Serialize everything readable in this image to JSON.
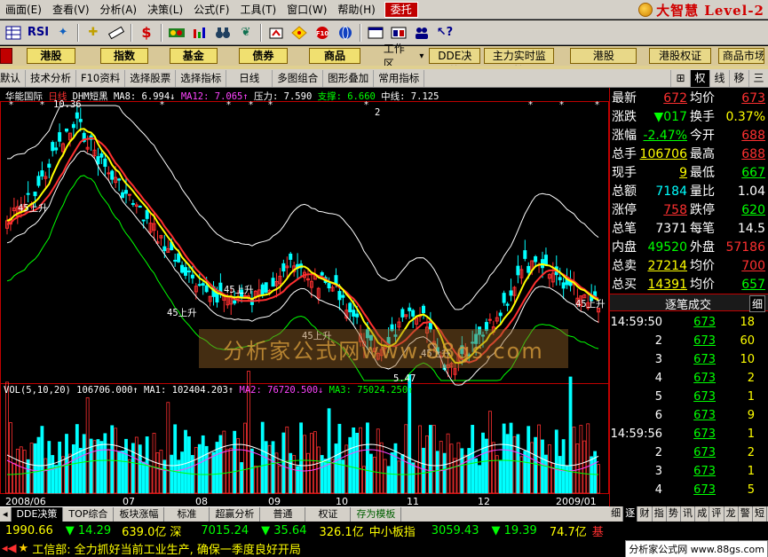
{
  "menu": {
    "items": [
      "画面(E)",
      "查看(V)",
      "分析(A)",
      "决策(L)",
      "公式(F)",
      "工具(T)",
      "窗口(W)",
      "帮助(H)"
    ],
    "hot_button": "委托",
    "brand": "大智慧 Level-2"
  },
  "toolbar": {
    "icons": [
      "grid-icon",
      "rsi-icon",
      "star-icon",
      "move-icon",
      "ruler-icon",
      "money-icon",
      "pattern-icon",
      "flow-icon",
      "binoculars-icon",
      "bird-icon",
      "target-icon",
      "diamond-icon",
      "f10-icon",
      "globe-icon",
      "window-icon",
      "board-icon",
      "users-icon",
      "help-icon"
    ],
    "rsi_label": "RSI"
  },
  "funcbar": {
    "left_buttons": [
      "港股",
      "指数",
      "基金",
      "债券",
      "商品"
    ],
    "workspace_label": "工作区",
    "right_buttons": [
      "DDE决策",
      "主力实时监控",
      "港股",
      "港股权证",
      "商品市场"
    ]
  },
  "subbar": {
    "items": [
      "默认",
      "技术分析",
      "F10资料",
      "选择股票",
      "选择指标",
      "日线",
      "多图组合",
      "图形叠加",
      "常用指标"
    ],
    "tabs": [
      "⊞",
      "权",
      "线",
      "移",
      "三"
    ]
  },
  "chart": {
    "title": "华能国际",
    "period": "日线",
    "indicator": "DHM短黑",
    "ma_text": [
      {
        "text": "MA8: 6.994↓",
        "color": "#ffffff"
      },
      {
        "text": "MA12: 7.065↑",
        "color": "#ff44ff"
      },
      {
        "text": "压力: 7.590",
        "color": "#ffffff"
      },
      {
        "text": "支撑: 6.660",
        "color": "#00ff00"
      },
      {
        "text": "中线: 7.125",
        "color": "#ffffff"
      }
    ],
    "price_max_label": "10.36",
    "price_min_label": "5.47",
    "marker_2": "2",
    "signals": [
      "45上升",
      "45上升",
      "45上升",
      "45上升",
      "45上升",
      "45上升",
      "45上升"
    ],
    "volume_text": [
      {
        "text": "VOL(5,10,20)",
        "color": "#ffffff"
      },
      {
        "text": "106706.000↑",
        "color": "#ffffff"
      },
      {
        "text": "MA1: 102404.203↑",
        "color": "#ffffff"
      },
      {
        "text": "MA2: 76720.500↓",
        "color": "#ff44ff"
      },
      {
        "text": "MA3: 75024.250↑",
        "color": "#00ff00"
      }
    ],
    "x_axis": [
      "2008/06",
      "07",
      "08",
      "09",
      "10",
      "11",
      "12",
      "2009/01"
    ],
    "watermark": "分析家公式网www.88gs.com",
    "colors": {
      "up": "#ff3030",
      "down": "#00ffff",
      "ma8": "#ffff00",
      "ma12": "#ff3030",
      "band": "#ffffff",
      "support": "#00ff00"
    }
  },
  "quote": {
    "rows": [
      {
        "l": "最新",
        "v": "672",
        "vc": "#ff3030",
        "l2": "均价",
        "v2": "673",
        "v2c": "#ff3030",
        "u": true
      },
      {
        "l": "涨跌",
        "v": "▼017",
        "vc": "#00ff00",
        "l2": "换手",
        "v2": "0.37%",
        "v2c": "#ffff00"
      },
      {
        "l": "涨幅",
        "v": "-2.47%",
        "vc": "#00ff00",
        "l2": "今开",
        "v2": "688",
        "v2c": "#ff3030",
        "u": true
      },
      {
        "l": "总手",
        "v": "106706",
        "vc": "#ffff00",
        "l2": "最高",
        "v2": "688",
        "v2c": "#ff3030",
        "u": true
      },
      {
        "l": "现手",
        "v": "9",
        "vc": "#ffff00",
        "l2": "最低",
        "v2": "667",
        "v2c": "#00ff00",
        "u": true
      },
      {
        "l": "总额",
        "v": "7184",
        "vc": "#00ffff",
        "l2": "量比",
        "v2": "1.04",
        "v2c": "#ffffff"
      },
      {
        "l": "涨停",
        "v": "758",
        "vc": "#ff3030",
        "l2": "跌停",
        "v2": "620",
        "v2c": "#00ff00",
        "u": true
      },
      {
        "l": "总笔",
        "v": "7371",
        "vc": "#ffffff",
        "l2": "每笔",
        "v2": "14.5",
        "v2c": "#ffffff"
      },
      {
        "l": "内盘",
        "v": "49520",
        "vc": "#00ff00",
        "l2": "外盘",
        "v2": "57186",
        "v2c": "#ff3030"
      },
      {
        "l": "总卖",
        "v": "27214",
        "vc": "#ffff00",
        "l2": "均价",
        "v2": "700",
        "v2c": "#ff3030",
        "u": true
      },
      {
        "l": "总买",
        "v": "14391",
        "vc": "#ffff00",
        "l2": "均价",
        "v2": "657",
        "v2c": "#00ff00",
        "u": true
      }
    ],
    "ticks_title": "逐笔成交",
    "ticks_btn": "细",
    "ticks": [
      {
        "t": "14:59:50",
        "p": "673",
        "v": "18"
      },
      {
        "t": "2",
        "p": "673",
        "v": "60"
      },
      {
        "t": "3",
        "p": "673",
        "v": "10"
      },
      {
        "t": "4",
        "p": "673",
        "v": "2"
      },
      {
        "t": "5",
        "p": "673",
        "v": "1"
      },
      {
        "t": "6",
        "p": "673",
        "v": "9"
      },
      {
        "t": "14:59:56",
        "p": "673",
        "v": "1"
      },
      {
        "t": "2",
        "p": "673",
        "v": "2"
      },
      {
        "t": "3",
        "p": "673",
        "v": "1"
      },
      {
        "t": "4",
        "p": "673",
        "v": "5"
      }
    ],
    "bottom_tabs": [
      "细",
      "逐",
      "财",
      "指",
      "势",
      "讯",
      "成",
      "评",
      "龙",
      "警",
      "短"
    ]
  },
  "bottomtabs": {
    "items": [
      "DDE决策",
      "TOP综合",
      "板块涨幅",
      "标准",
      "超赢分析",
      "普通",
      "权证",
      "存为模板"
    ]
  },
  "indexbar": {
    "items": [
      {
        "text": "1990.66",
        "color": "#ffff00"
      },
      {
        "text": "▼ 14.29",
        "color": "#00ff00"
      },
      {
        "text": "639.0亿",
        "color": "#ffff00"
      },
      {
        "text": "深",
        "color": "#ffff00"
      },
      {
        "text": "7015.24",
        "color": "#00ff00"
      },
      {
        "text": "▼ 35.64",
        "color": "#00ff00"
      },
      {
        "text": "326.1亿",
        "color": "#ffff00"
      },
      {
        "text": "中小板指",
        "color": "#ffff00"
      },
      {
        "text": "3059.43",
        "color": "#00ff00"
      },
      {
        "text": "▼ 19.39",
        "color": "#00ff00"
      },
      {
        "text": "74.7亿",
        "color": "#ffff00"
      },
      {
        "text": "基",
        "color": "#ff3030"
      }
    ]
  },
  "news": {
    "label": "工信部:",
    "text": "全力抓好当前工业生产, 确保一季度良好开局",
    "badge": "分析家公式网 www.88gs.com"
  }
}
